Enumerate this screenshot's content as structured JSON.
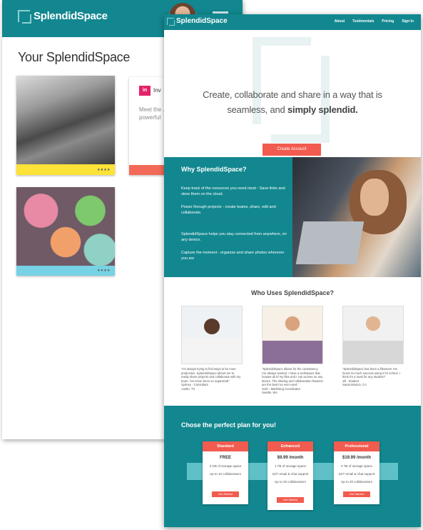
{
  "brand": "SplendidSpace",
  "back_window": {
    "title": "Your SplendidSpace",
    "card_label": "Inv",
    "card_text": "Meet the ... powerful",
    "card_dots": "●●●●"
  },
  "front_window": {
    "nav_links": [
      "About",
      "Testimonials",
      "Pricing",
      "Sign In"
    ],
    "hero": {
      "line1": "Create, collaborate and share in a way that is",
      "line2_plain": "seamless, and",
      "line2_bold": "simply splendid.",
      "cta": "Create Account"
    },
    "why": {
      "title": "Why SplendidSpace?",
      "points": [
        "Keep track of the resources you need most - Save links and store them on the cloud.",
        "Power through projects - create teams, share, edit and collaborate.",
        "SplendidSpace helps you stay connected from anywhere, on any device.",
        "Capture the moment - organize and share photos wherever you are"
      ]
    },
    "who": {
      "title": "Who Uses SplendidSpace?",
      "testimonials": [
        {
          "quote": "\"I'm always trying to find ways to be more productive. SplendidSpace allows me to easily share projects and collaborate with my team. I've never been so organized!\"",
          "name": "Sydney - Consultant",
          "place": "Austin, TX"
        },
        {
          "quote": "\"SplendidSpace allows for the consistency I've always wanted. I have a workspace that houses all of my files and I can access on any device. The sharing and collaboration features are the best I've ever used.\"",
          "name": "Josh - Marketing Coordinator",
          "place": "Seattle, WA"
        },
        {
          "quote": "\"SplendidSpace has been a lifesaver! I've found so much success using it for school. I think it's a must for any student!\"",
          "name": "Jill - Student",
          "place": "Santa Monica, CA"
        }
      ]
    },
    "plans": {
      "title": "Chose the perfect plan for you!",
      "items": [
        {
          "name": "Standard",
          "price": "FREE",
          "features": [
            "2 GB of storage space",
            "Up to 10 collaborators"
          ],
          "button": "Get Started"
        },
        {
          "name": "Enhanced",
          "price": "$9.99 /month",
          "features": [
            "1 TB of storage space",
            "24/7 email & chat support",
            "Up to 20 collaborators"
          ],
          "button": "Get Started"
        },
        {
          "name": "Professional",
          "price": "$19.99 /month",
          "features": [
            "2 TB of storage space",
            "24/7 email & chat support",
            "Up to 20 collaborators"
          ],
          "button": "Get Started"
        }
      ]
    }
  }
}
